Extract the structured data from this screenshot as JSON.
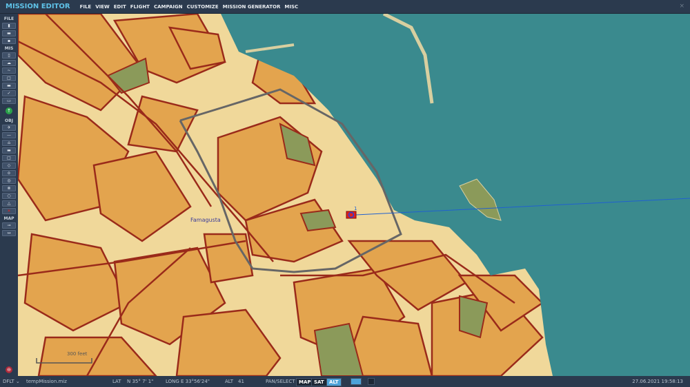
{
  "header": {
    "title": "MISSION EDITOR",
    "menu": [
      "FILE",
      "VIEW",
      "EDIT",
      "FLIGHT",
      "CAMPAIGN",
      "CUSTOMIZE",
      "MISSION GENERATOR",
      "MISC"
    ],
    "close": "×"
  },
  "toolbar": {
    "file": "FILE",
    "mis": "MIS",
    "obj": "OBJ",
    "map": "MAP"
  },
  "map": {
    "city_label": "Famagusta",
    "scale_label": "300 feet",
    "unit_number": "1",
    "unit_color": "#e0201c",
    "sea_color": "#3a8a8e"
  },
  "status": {
    "profile": "DFLT ⌄",
    "file": "tempMission.miz",
    "lat_label": "LAT",
    "lat": "N 35° 7' 1\"",
    "long_label": "LONG",
    "long": "E 33°56'24\"",
    "alt_label": "ALT",
    "alt": "41",
    "mode": "PAN/SELECT",
    "map_btn": "MAP",
    "sat_btn": "SAT",
    "alt_btn": "ALT",
    "datetime": "27.06.2021 19:58:13"
  }
}
